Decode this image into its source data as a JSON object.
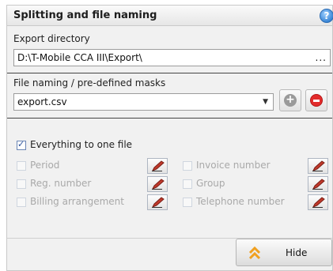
{
  "header": {
    "title": "Splitting and file naming",
    "help_icon": "?"
  },
  "export_directory": {
    "label": "Export directory",
    "value": "D:\\T-Mobile CCA III\\Export\\",
    "browse_label": "..."
  },
  "file_naming": {
    "label": "File naming / pre-defined masks",
    "value": "export.csv",
    "add_icon": "+"
  },
  "everything_one_file": {
    "label": "Everything to one file",
    "checked": true
  },
  "options_left": [
    {
      "label": "Period",
      "checked": false
    },
    {
      "label": "Reg. number",
      "checked": false
    },
    {
      "label": "Billing arrangement",
      "checked": false
    }
  ],
  "options_right": [
    {
      "label": "Invoice number",
      "checked": false
    },
    {
      "label": "Group",
      "checked": false
    },
    {
      "label": "Telephone number",
      "checked": false
    }
  ],
  "footer": {
    "hide_label": "Hide"
  },
  "colors": {
    "accent_blue": "#3a86d6",
    "remove_red": "#e22b2b",
    "disabled_text": "#a9a9a9",
    "hide_arrow": "#f0a020"
  }
}
